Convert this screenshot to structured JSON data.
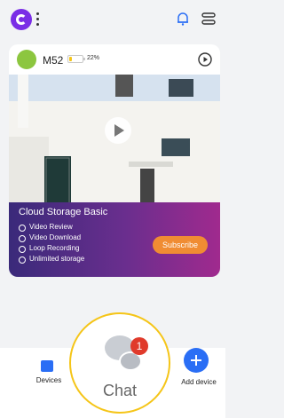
{
  "header": {
    "logo_icon": "app-logo-icon",
    "more_icon": "more-vertical-icon",
    "bell_icon": "bell-icon",
    "menu_icon": "list-menu-icon"
  },
  "device": {
    "name": "M52",
    "battery_percent": "22%",
    "battery_level": 0.22,
    "status_icon": "device-icon",
    "playback_icon": "playback-icon"
  },
  "preview": {
    "play_icon": "play-icon"
  },
  "promo": {
    "title": "Cloud Storage Basic",
    "features": [
      "Video Review",
      "Video Download",
      "Loop Recording",
      "Unlimited storage"
    ],
    "subscribe_label": "Subscribe"
  },
  "tabs": {
    "devices_label": "Devices",
    "chat_label": "Chat",
    "chat_badge": "1",
    "add_label": "Add device"
  },
  "colors": {
    "accent": "#2a6ef5",
    "highlight": "#f5c518",
    "badge": "#e03a2b",
    "subscribe": "#f08c33"
  }
}
